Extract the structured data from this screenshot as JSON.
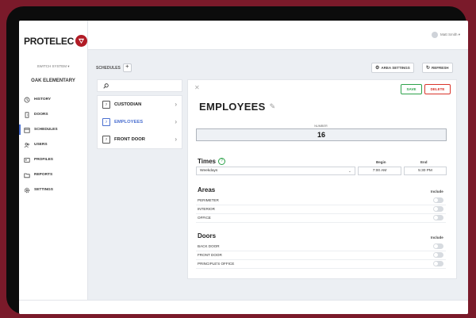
{
  "brand": {
    "name": "PROTELEC",
    "accent": "#b11c26",
    "link_color": "#4a6fd0"
  },
  "sidebar": {
    "system_switch": "SWITCH SYSTEM ▾",
    "site_name": "OAK ELEMENTARY",
    "items": [
      {
        "label": "HISTORY",
        "icon": "history-icon"
      },
      {
        "label": "DOORS",
        "icon": "door-icon"
      },
      {
        "label": "SCHEDULES",
        "icon": "calendar-icon",
        "active": true
      },
      {
        "label": "USERS",
        "icon": "users-icon"
      },
      {
        "label": "PROFILES",
        "icon": "profile-card-icon"
      },
      {
        "label": "REPORTS",
        "icon": "folder-icon"
      },
      {
        "label": "SETTINGS",
        "icon": "gear-icon"
      }
    ]
  },
  "topbar": {
    "user_name": "Matt Smith ▾"
  },
  "header": {
    "section": "SCHEDULES",
    "add": "+",
    "area_settings": "AREA SETTINGS",
    "refresh": "REFRESH"
  },
  "schedule_list": {
    "items": [
      {
        "label": "CUSTODIAN",
        "icon_text": "7"
      },
      {
        "label": "EMPLOYEES",
        "icon_text": "7",
        "active": true
      },
      {
        "label": "FRONT DOOR",
        "icon_text": "7"
      }
    ]
  },
  "detail": {
    "save": "SAVE",
    "delete": "DELETE",
    "title": "EMPLOYEES",
    "number_label": "NUMBER",
    "number": "16",
    "times": {
      "heading": "Times",
      "help": "?",
      "begin_label": "Begin",
      "end_label": "End",
      "day": "Weekdays",
      "begin": "7:00 AM",
      "end": "5:30 PM"
    },
    "areas": {
      "heading": "Areas",
      "include_label": "Include",
      "rows": [
        "PERIMETER",
        "INTERIOR",
        "OFFICE"
      ]
    },
    "doors": {
      "heading": "Doors",
      "include_label": "Include",
      "rows": [
        "BACK DOOR",
        "FRONT DOOR",
        "PRINCIPLE'S OFFICE"
      ]
    }
  }
}
